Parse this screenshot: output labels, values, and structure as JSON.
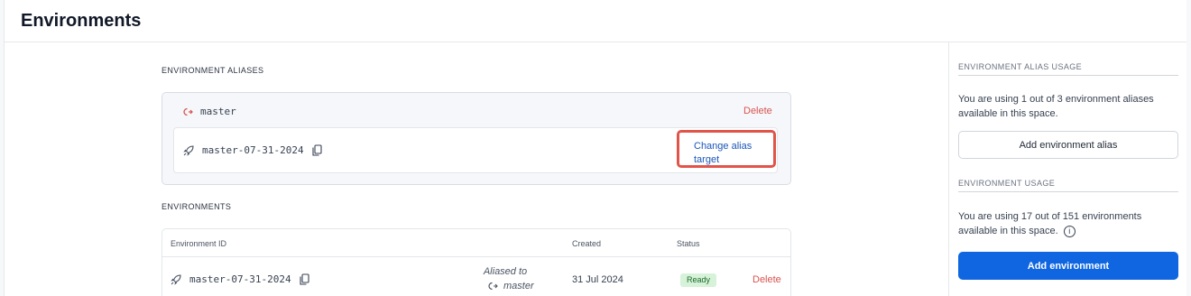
{
  "header": {
    "title": "Environments"
  },
  "aliases_section": {
    "label": "ENVIRONMENT ALIASES",
    "alias": {
      "name": "master",
      "delete_label": "Delete",
      "target": "master-07-31-2024",
      "change_target_label": "Change alias target"
    }
  },
  "environments_section": {
    "label": "ENVIRONMENTS",
    "columns": [
      "Environment ID",
      "Created",
      "Status"
    ],
    "rows": [
      {
        "id": "master-07-31-2024",
        "aliased_to_label": "Aliased to",
        "aliased_to": "master",
        "created": "31 Jul 2024",
        "status": "Ready",
        "delete_label": "Delete"
      }
    ]
  },
  "sidebar": {
    "alias_usage": {
      "label": "ENVIRONMENT ALIAS USAGE",
      "text": "You are using 1 out of 3 environment aliases available in this space.",
      "button": "Add environment alias"
    },
    "env_usage": {
      "label": "ENVIRONMENT USAGE",
      "text": "You are using 17 out of 151 environments available in this space.",
      "button": "Add environment"
    }
  },
  "colors": {
    "primary": "#0f66e0",
    "danger": "#d9534f",
    "highlight": "#e0544a",
    "ready_bg": "#d6f2d9"
  }
}
